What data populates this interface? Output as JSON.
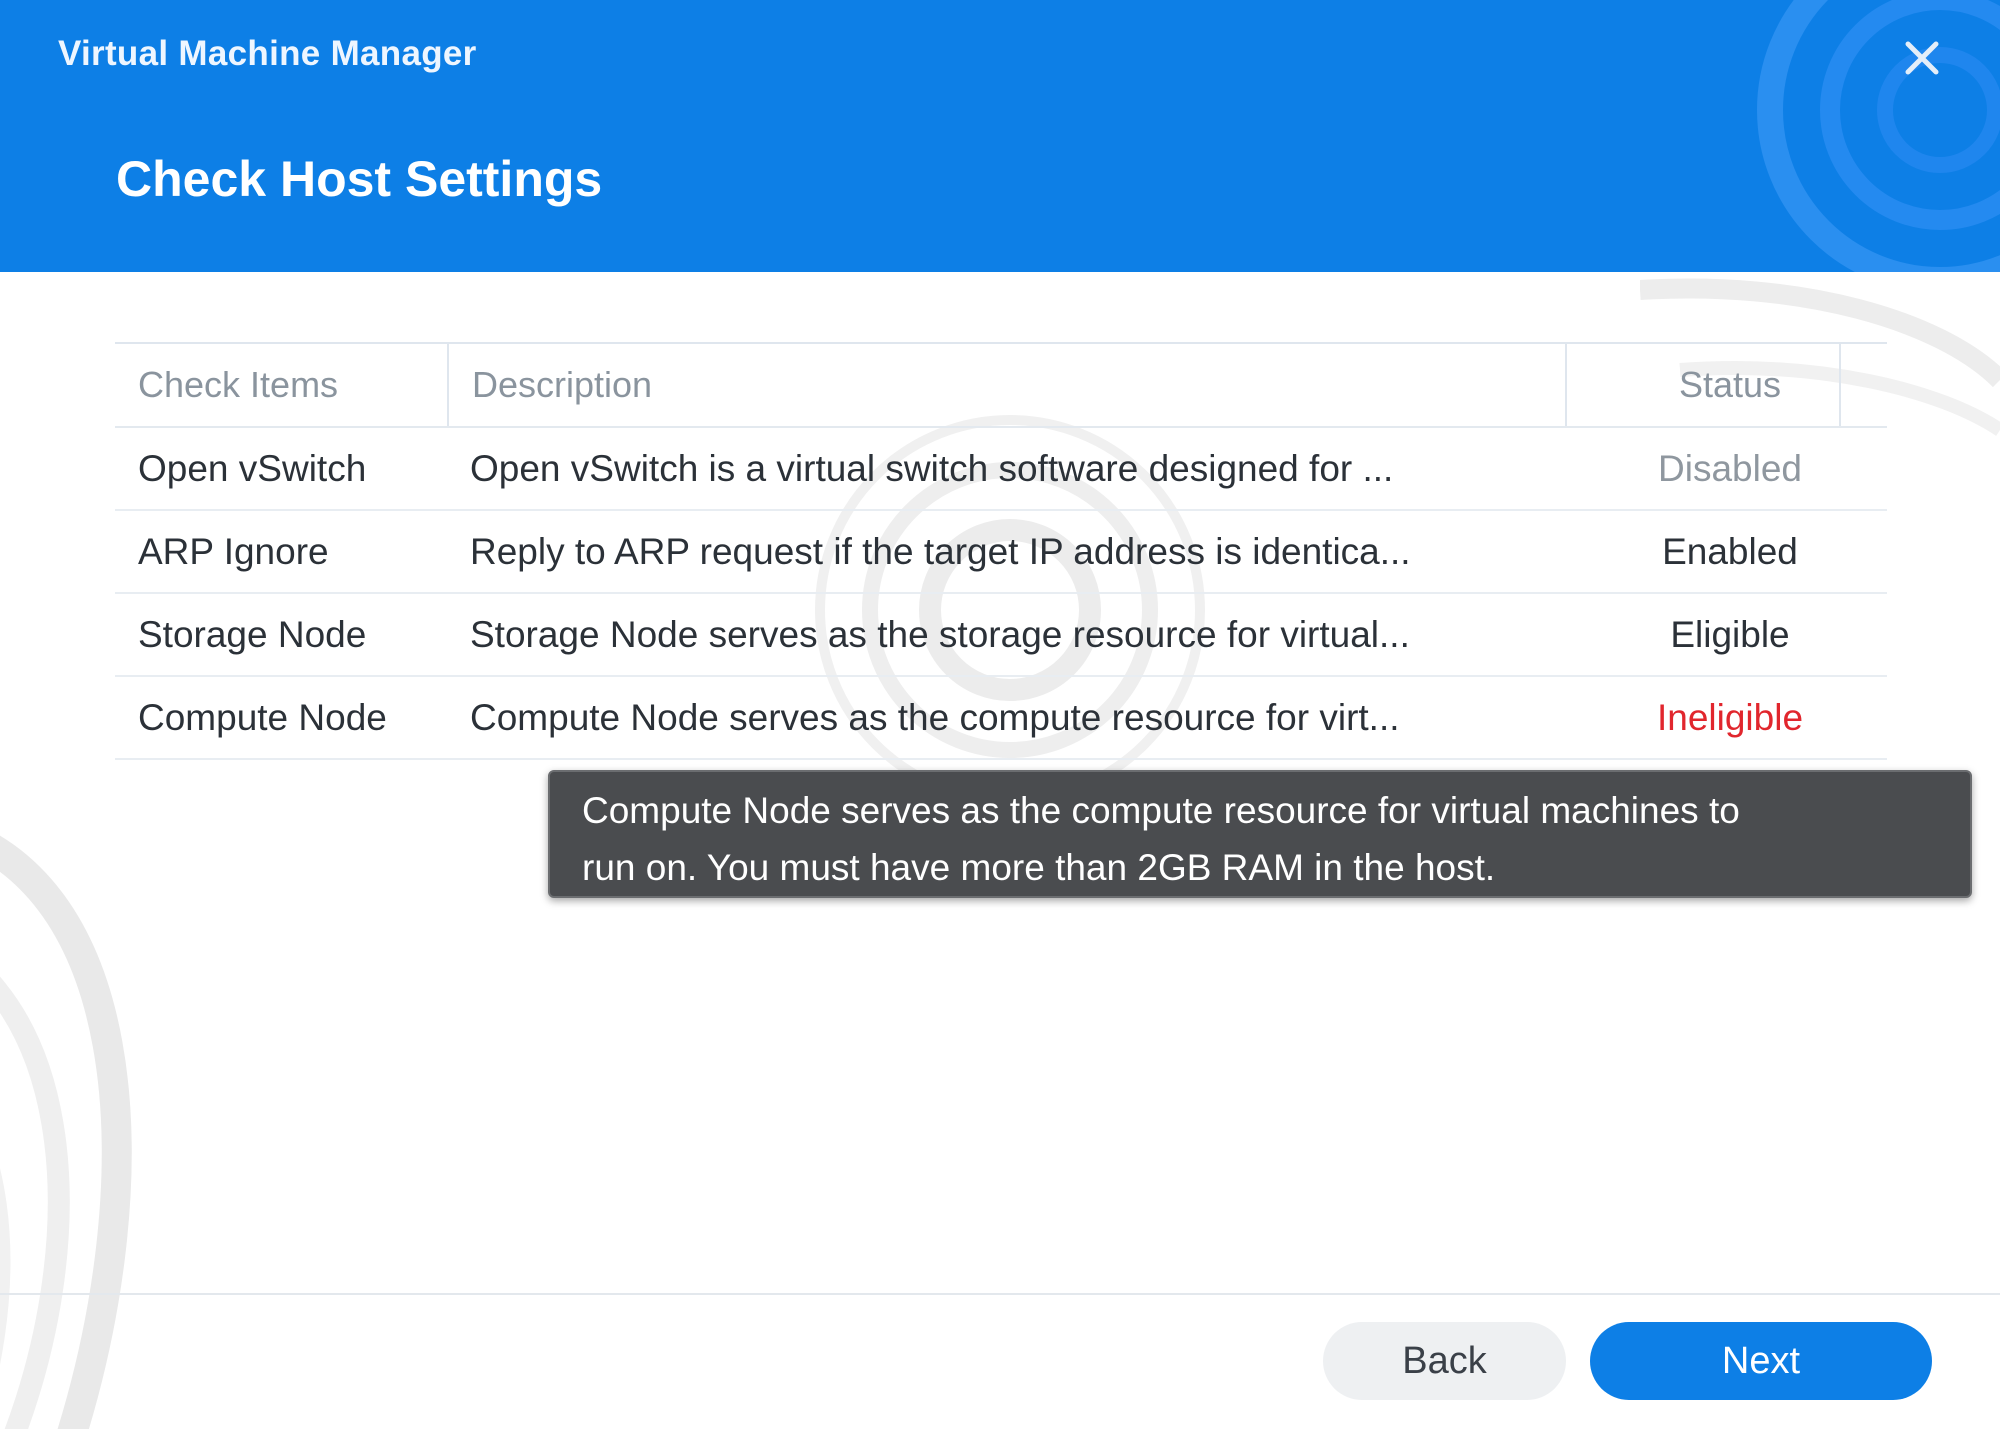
{
  "window": {
    "app_title": "Virtual Machine Manager",
    "page_title": "Check Host Settings",
    "close_icon": "close-icon"
  },
  "table": {
    "headers": {
      "items": "Check Items",
      "description": "Description",
      "status": "Status"
    },
    "rows": [
      {
        "item": "Open vSwitch",
        "description": "Open vSwitch is a virtual switch software designed for ...",
        "status": "Disabled"
      },
      {
        "item": "ARP Ignore",
        "description": "Reply to ARP request if the target IP address is identica...",
        "status": "Enabled"
      },
      {
        "item": "Storage Node",
        "description": "Storage Node serves as the storage resource for virtual...",
        "status": "Eligible"
      },
      {
        "item": "Compute Node",
        "description": "Compute Node serves as the compute resource for virt...",
        "status": "Ineligible"
      }
    ]
  },
  "tooltip": {
    "line1": "Compute Node serves as the compute resource for virtual machines to",
    "line2": "run on. You must have more than 2GB RAM in the host."
  },
  "footer": {
    "back_label": "Back",
    "next_label": "Next"
  },
  "colors": {
    "header_blue": "#0d7fe6",
    "ineligible_red": "#e1262d",
    "disabled_gray": "#8f979f"
  }
}
